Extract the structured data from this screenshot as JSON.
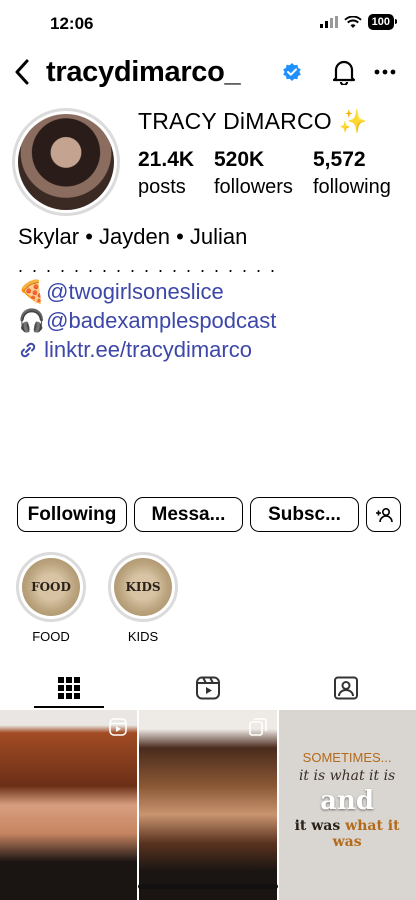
{
  "status_bar": {
    "time": "12:06",
    "battery": "100"
  },
  "profile": {
    "username": "tracydimarco_",
    "display_name": "TRACY DiMARCO ✨",
    "stats": {
      "posts_count": "21.4K",
      "posts_label": "posts",
      "followers_count": "520K",
      "followers_label": "followers",
      "following_count": "5,572",
      "following_label": "following"
    },
    "bio": {
      "line1": "Skylar • Jayden • Julian",
      "dots": ". . . . . . . . . . . . . . . . . . .",
      "emoji1": "🍕",
      "handle1": "@twogirlsoneslice",
      "emoji2": "🎧",
      "handle2": "@badexamplespodcast",
      "link": "linktr.ee/tracydimarco"
    }
  },
  "buttons": {
    "following": "Following",
    "message": "Messa...",
    "subscribe": "Subsc..."
  },
  "highlights": [
    {
      "label": "FOOD",
      "cover_text": "FOOD"
    },
    {
      "label": "KIDS",
      "cover_text": "KIDS"
    }
  ],
  "grid_quote": {
    "line1": "SOMETIMES...",
    "line2": "it is what it is",
    "line3": "and",
    "line4a": "it was ",
    "line4b": "what it was"
  },
  "colors": {
    "link": "#3d47a8",
    "verified": "#1e90ff",
    "border": "#dbdbdb"
  }
}
